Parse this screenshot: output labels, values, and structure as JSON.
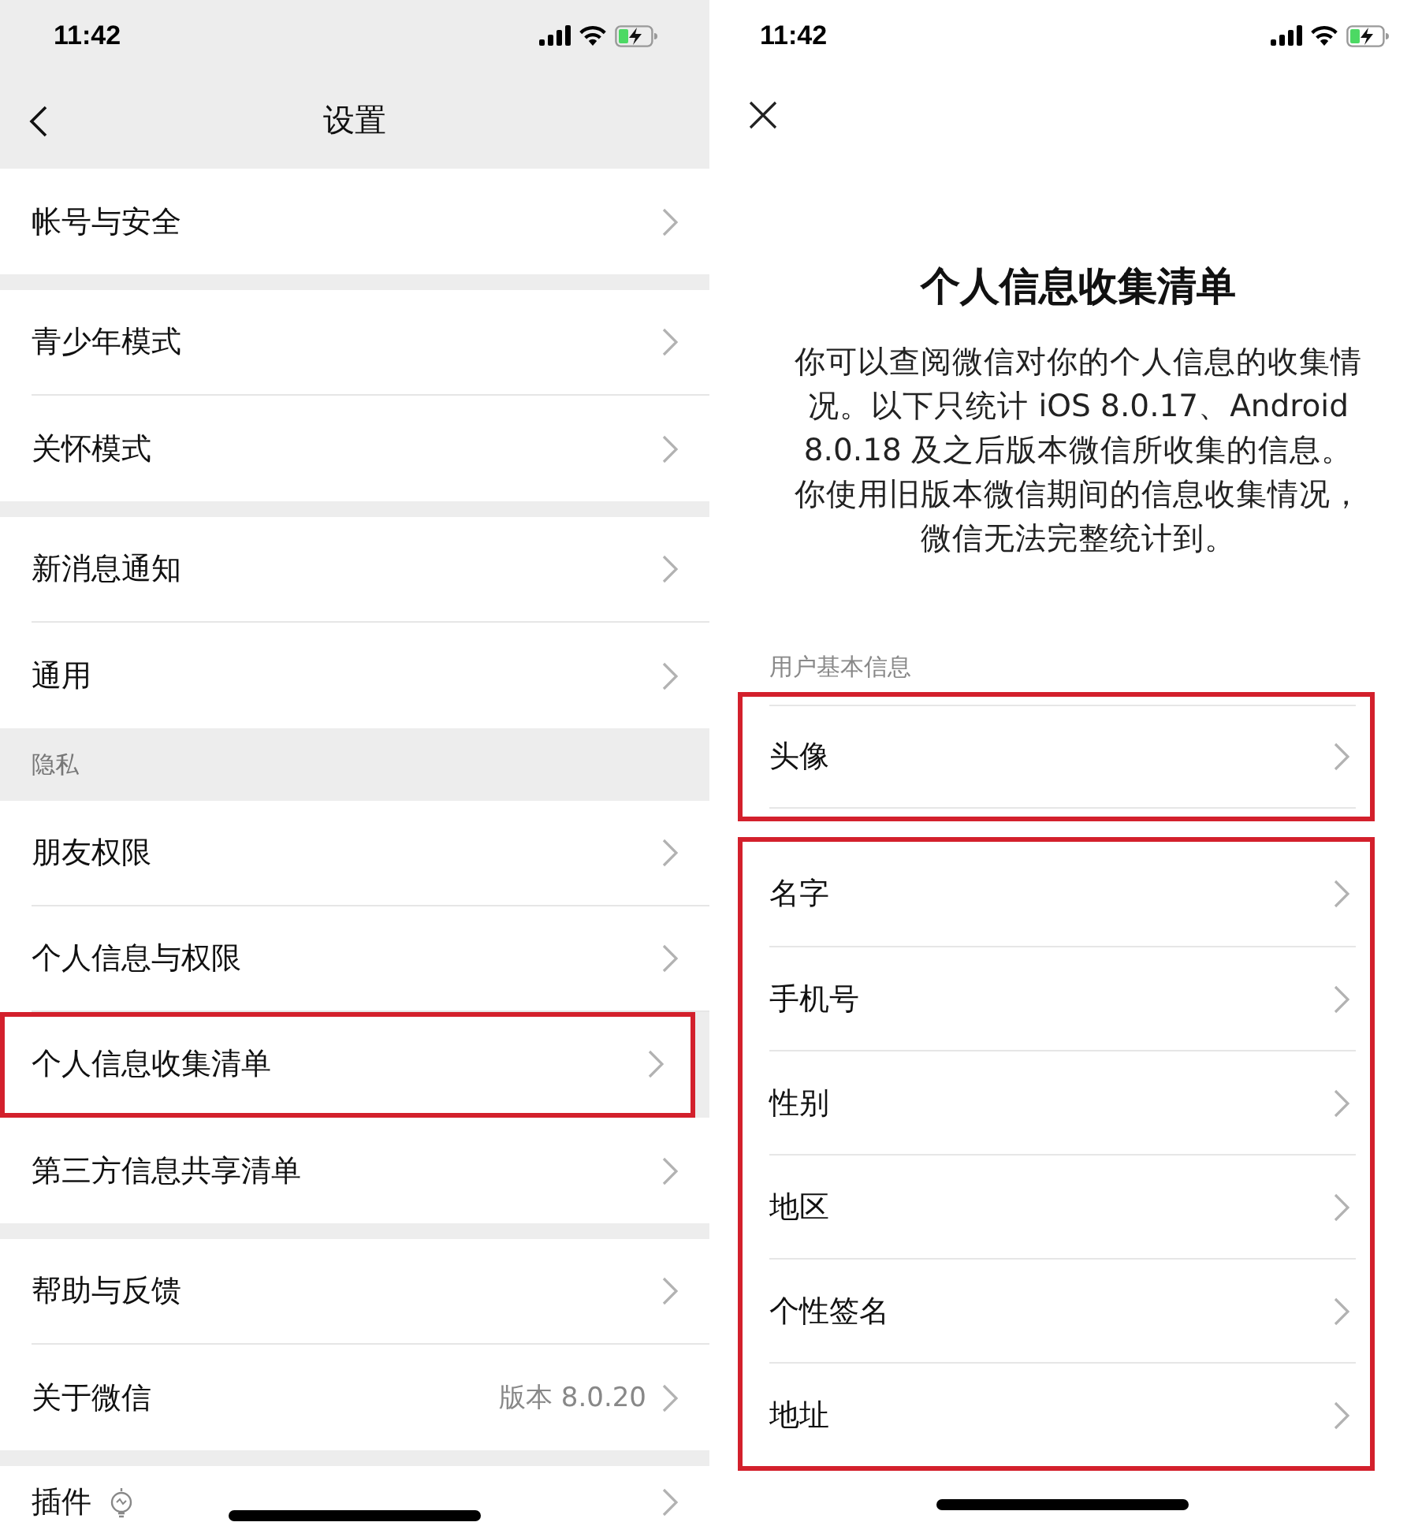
{
  "left": {
    "status": {
      "time": "11:42"
    },
    "title": "设置",
    "groups": [
      {
        "items": [
          {
            "kind": "link",
            "label": "帐号与安全",
            "highlighted": false
          }
        ]
      },
      {
        "items": [
          {
            "kind": "link",
            "label": "青少年模式",
            "highlighted": false
          },
          {
            "kind": "link",
            "label": "关怀模式",
            "highlighted": false
          }
        ]
      },
      {
        "items": [
          {
            "kind": "link",
            "label": "新消息通知",
            "highlighted": false
          },
          {
            "kind": "link",
            "label": "通用",
            "highlighted": false
          }
        ]
      },
      {
        "header": "隐私",
        "items": [
          {
            "kind": "link",
            "label": "朋友权限",
            "highlighted": false
          },
          {
            "kind": "link",
            "label": "个人信息与权限",
            "highlighted": false
          },
          {
            "kind": "link",
            "label": "个人信息收集清单",
            "highlighted": true
          },
          {
            "kind": "link",
            "label": "第三方信息共享清单",
            "highlighted": false
          }
        ]
      },
      {
        "items": [
          {
            "kind": "link",
            "label": "帮助与反馈",
            "highlighted": false
          },
          {
            "kind": "link",
            "label": "关于微信",
            "value": "版本 8.0.20",
            "highlighted": false
          }
        ]
      },
      {
        "items": [
          {
            "kind": "plugin",
            "label": "插件",
            "highlighted": false
          }
        ]
      }
    ]
  },
  "right": {
    "status": {
      "time": "11:42"
    },
    "title": "个人信息收集清单",
    "description": "你可以查阅微信对你的个人信息的收集情况。以下只统计 iOS 8.0.17、Android 8.0.18 及之后版本微信所收集的信息。你使用旧版本微信期间的信息收集情况，微信无法完整统计到。",
    "section": "用户基本信息",
    "groups": [
      {
        "highlighted": true,
        "items": [
          {
            "label": "头像"
          }
        ]
      },
      {
        "highlighted": true,
        "items": [
          {
            "label": "名字"
          },
          {
            "label": "手机号"
          },
          {
            "label": "性别"
          },
          {
            "label": "地区"
          },
          {
            "label": "个性签名"
          },
          {
            "label": "地址"
          }
        ]
      }
    ]
  }
}
